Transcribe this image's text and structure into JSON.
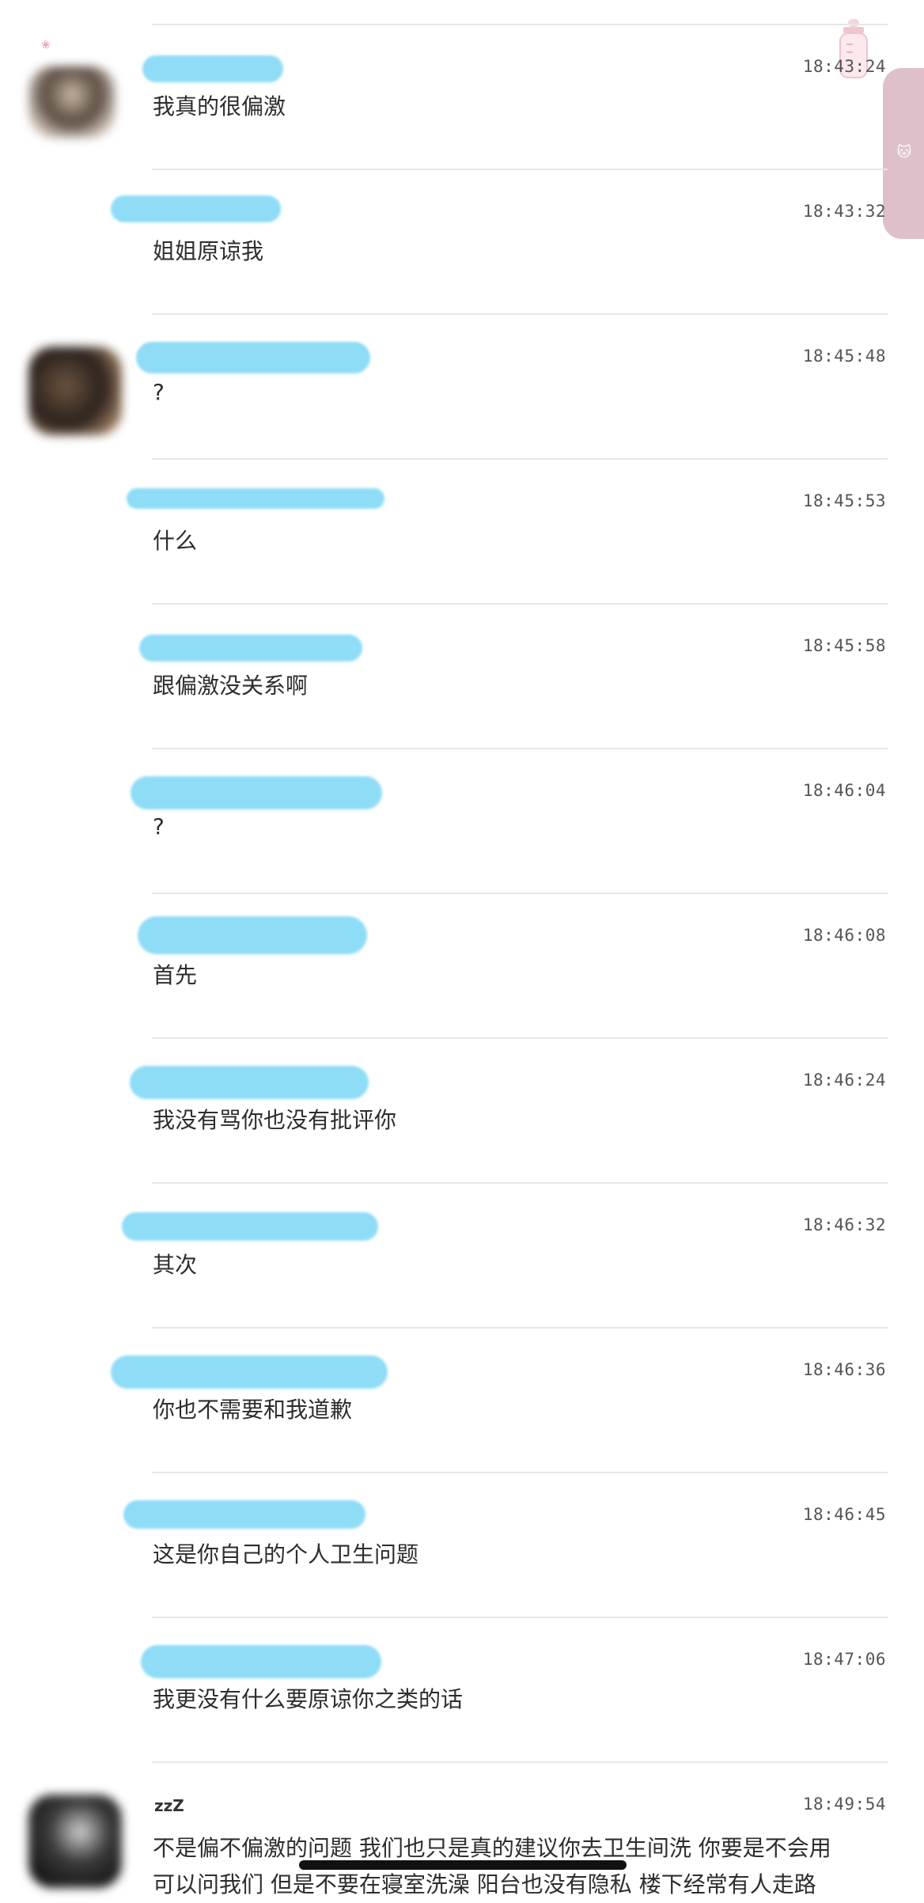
{
  "messages": [
    {
      "time": "18:43:24",
      "text": "我真的很偏激"
    },
    {
      "time": "18:43:32",
      "text": "姐姐原谅我"
    },
    {
      "time": "18:45:48",
      "text": "?"
    },
    {
      "time": "18:45:53",
      "text": "什么"
    },
    {
      "time": "18:45:58",
      "text": "跟偏激没关系啊"
    },
    {
      "time": "18:46:04",
      "text": "?"
    },
    {
      "time": "18:46:08",
      "text": "首先"
    },
    {
      "time": "18:46:24",
      "text": "我没有骂你也没有批评你"
    },
    {
      "time": "18:46:32",
      "text": "其次"
    },
    {
      "time": "18:46:36",
      "text": "你也不需要和我道歉"
    },
    {
      "time": "18:46:45",
      "text": "这是你自己的个人卫生问题"
    },
    {
      "time": "18:47:06",
      "text": "我更没有什么要原谅你之类的话"
    }
  ],
  "last_message": {
    "name": "zzZ",
    "time": "18:49:54",
    "line1": "不是偏不偏激的问题  我们也只是真的建议你去卫生间洗  你要是不会用",
    "line2": "可以问我们  但是不要在寝室洗澡  阳台也没有隐私  楼下经常有人走路"
  },
  "colors": {
    "redaction": "#8fdcf7",
    "divider": "#e6e6e6",
    "side_tab": "#d9b9c3"
  },
  "icons": [
    "baby-bottle-icon",
    "cat-face-icon"
  ]
}
